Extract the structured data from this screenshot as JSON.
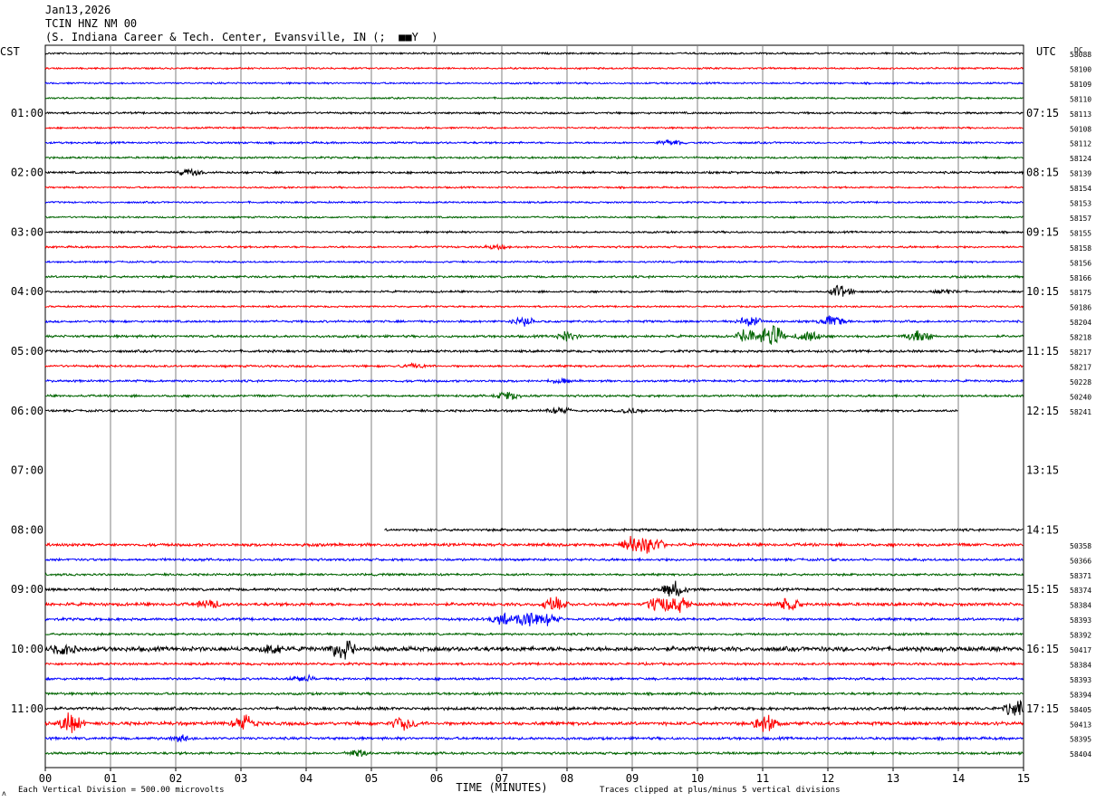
{
  "header": {
    "date": "Jan13,2026",
    "station": "TCIN HNZ NM 00",
    "location": "(S. Indiana Career & Tech. Center, Evansville, IN (;  ■■Y  )"
  },
  "chart_data": {
    "type": "line",
    "title": "TCIN HNZ NM 00",
    "left_timezone": "CST",
    "right_timezone": "UTC",
    "dc_label": "DC",
    "xlabel": "TIME (MINUTES)",
    "x_ticks": [
      "00",
      "01",
      "02",
      "03",
      "04",
      "05",
      "06",
      "07",
      "08",
      "09",
      "10",
      "11",
      "12",
      "13",
      "14",
      "15"
    ],
    "xlim": [
      0,
      15
    ],
    "left_hour_labels": [
      {
        "row": 4,
        "text": "01:00"
      },
      {
        "row": 8,
        "text": "02:00"
      },
      {
        "row": 12,
        "text": "03:00"
      },
      {
        "row": 16,
        "text": "04:00"
      },
      {
        "row": 20,
        "text": "05:00"
      },
      {
        "row": 24,
        "text": "06:00"
      },
      {
        "row": 28,
        "text": "07:00"
      },
      {
        "row": 32,
        "text": "08:00"
      },
      {
        "row": 36,
        "text": "09:00"
      },
      {
        "row": 40,
        "text": "10:00"
      },
      {
        "row": 44,
        "text": "11:00"
      }
    ],
    "right_hour_labels": [
      {
        "row": 4,
        "text": "07:15"
      },
      {
        "row": 8,
        "text": "08:15"
      },
      {
        "row": 12,
        "text": "09:15"
      },
      {
        "row": 16,
        "text": "10:15"
      },
      {
        "row": 20,
        "text": "11:15"
      },
      {
        "row": 24,
        "text": "12:15"
      },
      {
        "row": 28,
        "text": "13:15"
      },
      {
        "row": 32,
        "text": "14:15"
      },
      {
        "row": 36,
        "text": "15:15"
      },
      {
        "row": 40,
        "text": "16:15"
      },
      {
        "row": 44,
        "text": "17:15"
      }
    ],
    "traces": [
      {
        "row": 0,
        "dc": "58088",
        "start": 0,
        "end": 15,
        "amp": 0.8
      },
      {
        "row": 1,
        "dc": "58100",
        "start": 0,
        "end": 15,
        "amp": 0.8
      },
      {
        "row": 2,
        "dc": "58109",
        "start": 0,
        "end": 15,
        "amp": 0.8
      },
      {
        "row": 3,
        "dc": "58110",
        "start": 0,
        "end": 15,
        "amp": 0.8
      },
      {
        "row": 4,
        "dc": "58113",
        "start": 0,
        "end": 15,
        "amp": 0.9
      },
      {
        "row": 5,
        "dc": "50108",
        "start": 0,
        "end": 15,
        "amp": 0.8
      },
      {
        "row": 6,
        "dc": "58112",
        "start": 0,
        "end": 15,
        "amp": 0.9,
        "events": [
          [
            9.6,
            3
          ]
        ]
      },
      {
        "row": 7,
        "dc": "58124",
        "start": 0,
        "end": 15,
        "amp": 0.9
      },
      {
        "row": 8,
        "dc": "58139",
        "start": 0,
        "end": 15,
        "amp": 1.0,
        "events": [
          [
            2.2,
            3
          ]
        ]
      },
      {
        "row": 9,
        "dc": "58154",
        "start": 0,
        "end": 15,
        "amp": 0.8
      },
      {
        "row": 10,
        "dc": "58153",
        "start": 0,
        "end": 15,
        "amp": 0.8
      },
      {
        "row": 11,
        "dc": "58157",
        "start": 0,
        "end": 15,
        "amp": 0.8
      },
      {
        "row": 12,
        "dc": "58155",
        "start": 0,
        "end": 15,
        "amp": 0.9
      },
      {
        "row": 13,
        "dc": "58158",
        "start": 0,
        "end": 15,
        "amp": 0.9,
        "events": [
          [
            6.9,
            2
          ]
        ]
      },
      {
        "row": 14,
        "dc": "58156",
        "start": 0,
        "end": 15,
        "amp": 0.8
      },
      {
        "row": 15,
        "dc": "58166",
        "start": 0,
        "end": 15,
        "amp": 1.0
      },
      {
        "row": 16,
        "dc": "58175",
        "start": 0,
        "end": 15,
        "amp": 0.9,
        "events": [
          [
            12.2,
            6
          ],
          [
            13.8,
            2
          ]
        ]
      },
      {
        "row": 17,
        "dc": "50186",
        "start": 0,
        "end": 15,
        "amp": 0.8
      },
      {
        "row": 18,
        "dc": "58204",
        "start": 0,
        "end": 15,
        "amp": 1.0,
        "events": [
          [
            7.35,
            4
          ],
          [
            10.8,
            5
          ],
          [
            12.05,
            6
          ]
        ]
      },
      {
        "row": 19,
        "dc": "58218",
        "start": 0,
        "end": 15,
        "amp": 1.1,
        "events": [
          [
            8.0,
            4
          ],
          [
            10.8,
            8
          ],
          [
            11.15,
            10
          ],
          [
            11.7,
            6
          ],
          [
            13.4,
            7
          ]
        ]
      },
      {
        "row": 20,
        "dc": "58217",
        "start": 0,
        "end": 15,
        "amp": 1.1
      },
      {
        "row": 21,
        "dc": "58217",
        "start": 0,
        "end": 15,
        "amp": 1.0,
        "events": [
          [
            5.6,
            2
          ]
        ]
      },
      {
        "row": 22,
        "dc": "50228",
        "start": 0,
        "end": 15,
        "amp": 1.0,
        "events": [
          [
            7.9,
            2
          ]
        ]
      },
      {
        "row": 23,
        "dc": "50240",
        "start": 0,
        "end": 15,
        "amp": 1.0,
        "events": [
          [
            7.1,
            4
          ]
        ]
      },
      {
        "row": 24,
        "dc": "58241",
        "start": 0,
        "end": 14.0,
        "amp": 1.0,
        "events": [
          [
            7.9,
            3
          ],
          [
            9.0,
            2
          ]
        ]
      },
      {
        "row": 32,
        "dc": "",
        "start": 5.2,
        "end": 15,
        "amp": 1.1
      },
      {
        "row": 33,
        "dc": "50358",
        "start": 0,
        "end": 15,
        "amp": 1.3,
        "events": [
          [
            9.0,
            8
          ],
          [
            9.3,
            8
          ]
        ]
      },
      {
        "row": 34,
        "dc": "50366",
        "start": 0,
        "end": 15,
        "amp": 1.1
      },
      {
        "row": 35,
        "dc": "58371",
        "start": 0,
        "end": 15,
        "amp": 1.0
      },
      {
        "row": 36,
        "dc": "58374",
        "start": 0,
        "end": 15,
        "amp": 1.2,
        "events": [
          [
            9.65,
            8
          ]
        ]
      },
      {
        "row": 37,
        "dc": "58384",
        "start": 0,
        "end": 15,
        "amp": 1.4,
        "events": [
          [
            2.5,
            4
          ],
          [
            7.8,
            6
          ],
          [
            9.4,
            8
          ],
          [
            9.7,
            7
          ],
          [
            11.4,
            6
          ]
        ]
      },
      {
        "row": 38,
        "dc": "58393",
        "start": 0,
        "end": 15,
        "amp": 1.2,
        "events": [
          [
            7.0,
            6
          ],
          [
            7.4,
            8
          ],
          [
            7.7,
            5
          ]
        ]
      },
      {
        "row": 39,
        "dc": "58392",
        "start": 0,
        "end": 15,
        "amp": 1.0
      },
      {
        "row": 40,
        "dc": "50417",
        "start": 0,
        "end": 15,
        "amp": 2.0,
        "events": [
          [
            0.3,
            6
          ],
          [
            3.5,
            5
          ],
          [
            4.55,
            10
          ]
        ]
      },
      {
        "row": 41,
        "dc": "58384",
        "start": 0,
        "end": 15,
        "amp": 1.1
      },
      {
        "row": 42,
        "dc": "58393",
        "start": 0,
        "end": 15,
        "amp": 1.1,
        "events": [
          [
            3.95,
            3
          ]
        ]
      },
      {
        "row": 43,
        "dc": "58394",
        "start": 0,
        "end": 15,
        "amp": 1.1
      },
      {
        "row": 44,
        "dc": "58405",
        "start": 0,
        "end": 15,
        "amp": 1.3,
        "events": [
          [
            14.9,
            8
          ]
        ]
      },
      {
        "row": 45,
        "dc": "50413",
        "start": 0,
        "end": 15,
        "amp": 1.5,
        "events": [
          [
            0.4,
            10
          ],
          [
            3.05,
            8
          ],
          [
            5.5,
            7
          ],
          [
            11.05,
            9
          ]
        ]
      },
      {
        "row": 46,
        "dc": "58395",
        "start": 0,
        "end": 15,
        "amp": 1.2,
        "events": [
          [
            2.1,
            3
          ]
        ]
      },
      {
        "row": 47,
        "dc": "58404",
        "start": 0,
        "end": 15,
        "amp": 1.1,
        "events": [
          [
            4.8,
            3
          ]
        ]
      }
    ],
    "trace_colors": [
      "#000000",
      "#ff0000",
      "#0000ff",
      "#006400"
    ],
    "grid": true
  },
  "footer": {
    "left_note": "Each Vertical Division =  500.00 microvolts",
    "right_note": "Traces clipped at plus/minus 5 vertical divisions",
    "corner_mark": "ʌ"
  }
}
